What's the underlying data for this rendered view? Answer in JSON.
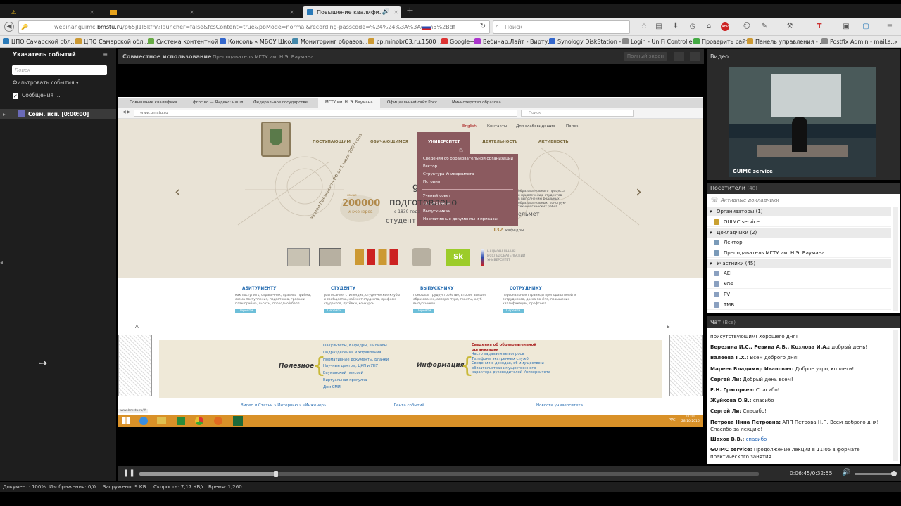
{
  "browser": {
    "tabs": [
      {
        "label": "",
        "icon": "warning-icon"
      },
      {
        "label": "",
        "icon": "gmail-icon"
      },
      {
        "label": "",
        "icon": ""
      },
      {
        "label": "Повышение квалифи...",
        "icon": "page-icon",
        "active": true
      }
    ],
    "url_prefix": "webinar.guimc.",
    "url_domain": "bmstu.ru",
    "url_rest": "/p65jl1l5kfh/?launcher=false&fcsContent=true&pbMode=normal&recording-passcode=%24%24%3A%3AgIqh5%2Bdf",
    "search_placeholder": "Поиск",
    "bookmarks": [
      "ЦПО Самарской обл...",
      "ЦПО Самарской обл...",
      "Система контентной ...",
      "Консоль « МБОУ Шко...",
      "Мониторинг образов...",
      "cp.minobr63.ru:1500 :...",
      "Google+",
      "Вебинар.Лайт - Вирту...",
      "Synology DiskStation - ...",
      "Login - UniFi Controller",
      "Проверить сайт",
      "Панель управления - ...",
      "Postfix Admin - mail.s..."
    ]
  },
  "left_panel": {
    "title": "Указатель событий",
    "search_placeholder": "Поиск",
    "filter_label": "Фильтровать события",
    "messages_label": "Сообщения ...",
    "tree_item": "Совм. исп. [0:00:00]"
  },
  "center": {
    "title": "Совместное использование",
    "subtitle": "Преподаватель МГТУ им. Н.Э. Баумана",
    "fullscreen_label": "Полный экран"
  },
  "shared_screen": {
    "tabs": [
      "Повышение квалифика...",
      "фгос во — Яндекс: нашл...",
      "Федеральное государствен...",
      "МГТУ им. Н. Э. Баумана",
      "Официальный сайт Росс...",
      "Министерство образова..."
    ],
    "url": "www.bmstu.ru",
    "search_placeholder": "Поиск",
    "top_nav": [
      "English",
      "Контакты",
      "Для слабовидящих",
      "Поиск"
    ],
    "main_nav": [
      "ПОСТУПАЮЩИМ",
      "ОБУЧАЮЩИМСЯ",
      "УНИВЕРСИТЕТ",
      "ДЕЯТЕЛЬНОСТЬ",
      "АКТИВНОСТЬ"
    ],
    "dropdown": [
      "Сведения об образовательной организации",
      "Ректор",
      "Структура Университета",
      "История",
      "Ученый совет",
      "Сотрудникам",
      "Выпускникам",
      "Нормативные документы и приказы"
    ],
    "hero": {
      "count": "200000",
      "count_label": "инженеров",
      "prepared": "подготовлено",
      "since": "с 1830 года",
      "students": "студент",
      "departments_num": "132",
      "departments": "кафедры",
      "sidebar_text": "образовательного процесса\nк привлечению студентов\nв выполнению реальных\nобразовательных, конструк-\nтехнологических работ",
      "motto": "ельмет",
      "decree": "Указом Президента РФ от 1 июля 2009 года"
    },
    "quick": [
      {
        "title": "АБИТУРИЕНТУ",
        "desc": "как поступить, справочник, правила приёма, схема поступления, подготовка, графики план приёма, льготы, проходной балл",
        "btn": "Перейти"
      },
      {
        "title": "СТУДЕНТУ",
        "desc": "расписание, стипендии, студенческие клубы и сообщества, кабинет студента, профком студентов, путёвки, конкурсы",
        "btn": "Перейти"
      },
      {
        "title": "ВЫПУСКНИКУ",
        "desc": "помощь в трудоустройстве, второе высшее образование, аспирантура, гранты, клуб выпускников",
        "btn": "Перейти"
      },
      {
        "title": "СОТРУДНИКУ",
        "desc": "персональные страницы преподавателей и сотрудников, доска почёта, повышение квалификации, профсоюз",
        "btn": "Перейти"
      }
    ],
    "useful_title": "Полезное",
    "useful_links": [
      "Факультеты, Кафедры, Филиалы",
      "Подразделения и Управления",
      "Нормативные документы, Бланки",
      "Научные центры, ЦКП и УНУ",
      "Бауманский поиссей",
      "Виртуальная прогулка",
      "Дом СМИ"
    ],
    "info_title": "Информация",
    "info_links": [
      "Сведения об образовательной организации",
      "Часто задаваемые вопросы",
      "Телефоны экстренных служб",
      "Сведения о доходах, об имуществе и обязательствах имущественного характера руководителей Университета"
    ],
    "bottom_links": [
      "Видео и Статьи  »  Интервью  »  «Инженер»",
      "Лента событий",
      "Новости университета"
    ],
    "status_url": "www.bmstu.ru/#",
    "tray_lang": "РУС",
    "tray_time": "11:11",
    "tray_date": "28.10.2016",
    "marker_a": "А",
    "marker_b": "Б"
  },
  "video": {
    "title": "Видео",
    "caption": "GUIMC service"
  },
  "attendees": {
    "title": "Посетители",
    "count": "(48)",
    "active_label": "Активные докладчики",
    "organizers_label": "Организаторы (1)",
    "organizers": [
      "GUIMC service"
    ],
    "speakers_label": "Докладчики (2)",
    "speakers": [
      "Лектор",
      "Преподаватель МГТУ им. Н.Э. Баумана"
    ],
    "participants_label": "Участники (45)",
    "participants": [
      "AEI",
      "KOA",
      "PV",
      "TMB"
    ]
  },
  "chat": {
    "title": "Чат",
    "scope": "(Все)",
    "messages": [
      {
        "author": "",
        "text": "присутствующим! Хорошего дня!"
      },
      {
        "author": "Березина И.С., Ревина А.В., Козлова И.А.:",
        "text": " добрый день!"
      },
      {
        "author": "Валеева Г.Х.:",
        "text": " Всем доброго дня!"
      },
      {
        "author": "Мареев Владимир Иванович:",
        "text": " Доброе утро, коллеги!"
      },
      {
        "author": "Сергей Ли:",
        "text": " Добрый день всем!"
      },
      {
        "author": "Е.Н. Григорьев:",
        "text": " Спасибо!"
      },
      {
        "author": "Жуйкова О.В.:",
        "text": " спасибо"
      },
      {
        "author": "Сергей Ли:",
        "text": " Спасибо!"
      },
      {
        "author": "Петрова Нина Петровна:",
        "text": " АПП   Петрова Н.П. Всем доброго дня! Спасибо за лекцию!"
      },
      {
        "author": "Шахов В.В.:",
        "text": " спасибо"
      },
      {
        "author": "GUIMC service:",
        "text": " Продолжение лекции в 11:05 в формате практического занятия"
      }
    ]
  },
  "player": {
    "time": "0:06:45/0:32:55",
    "progress": 0.22
  },
  "statusbar": {
    "document": "Документ: 100%",
    "images": "Изображения: 0/0",
    "loaded": "Загружено: 9 КБ",
    "speed": "Скорость: 7,17 КБ/с",
    "time": "Время: 1,260"
  }
}
